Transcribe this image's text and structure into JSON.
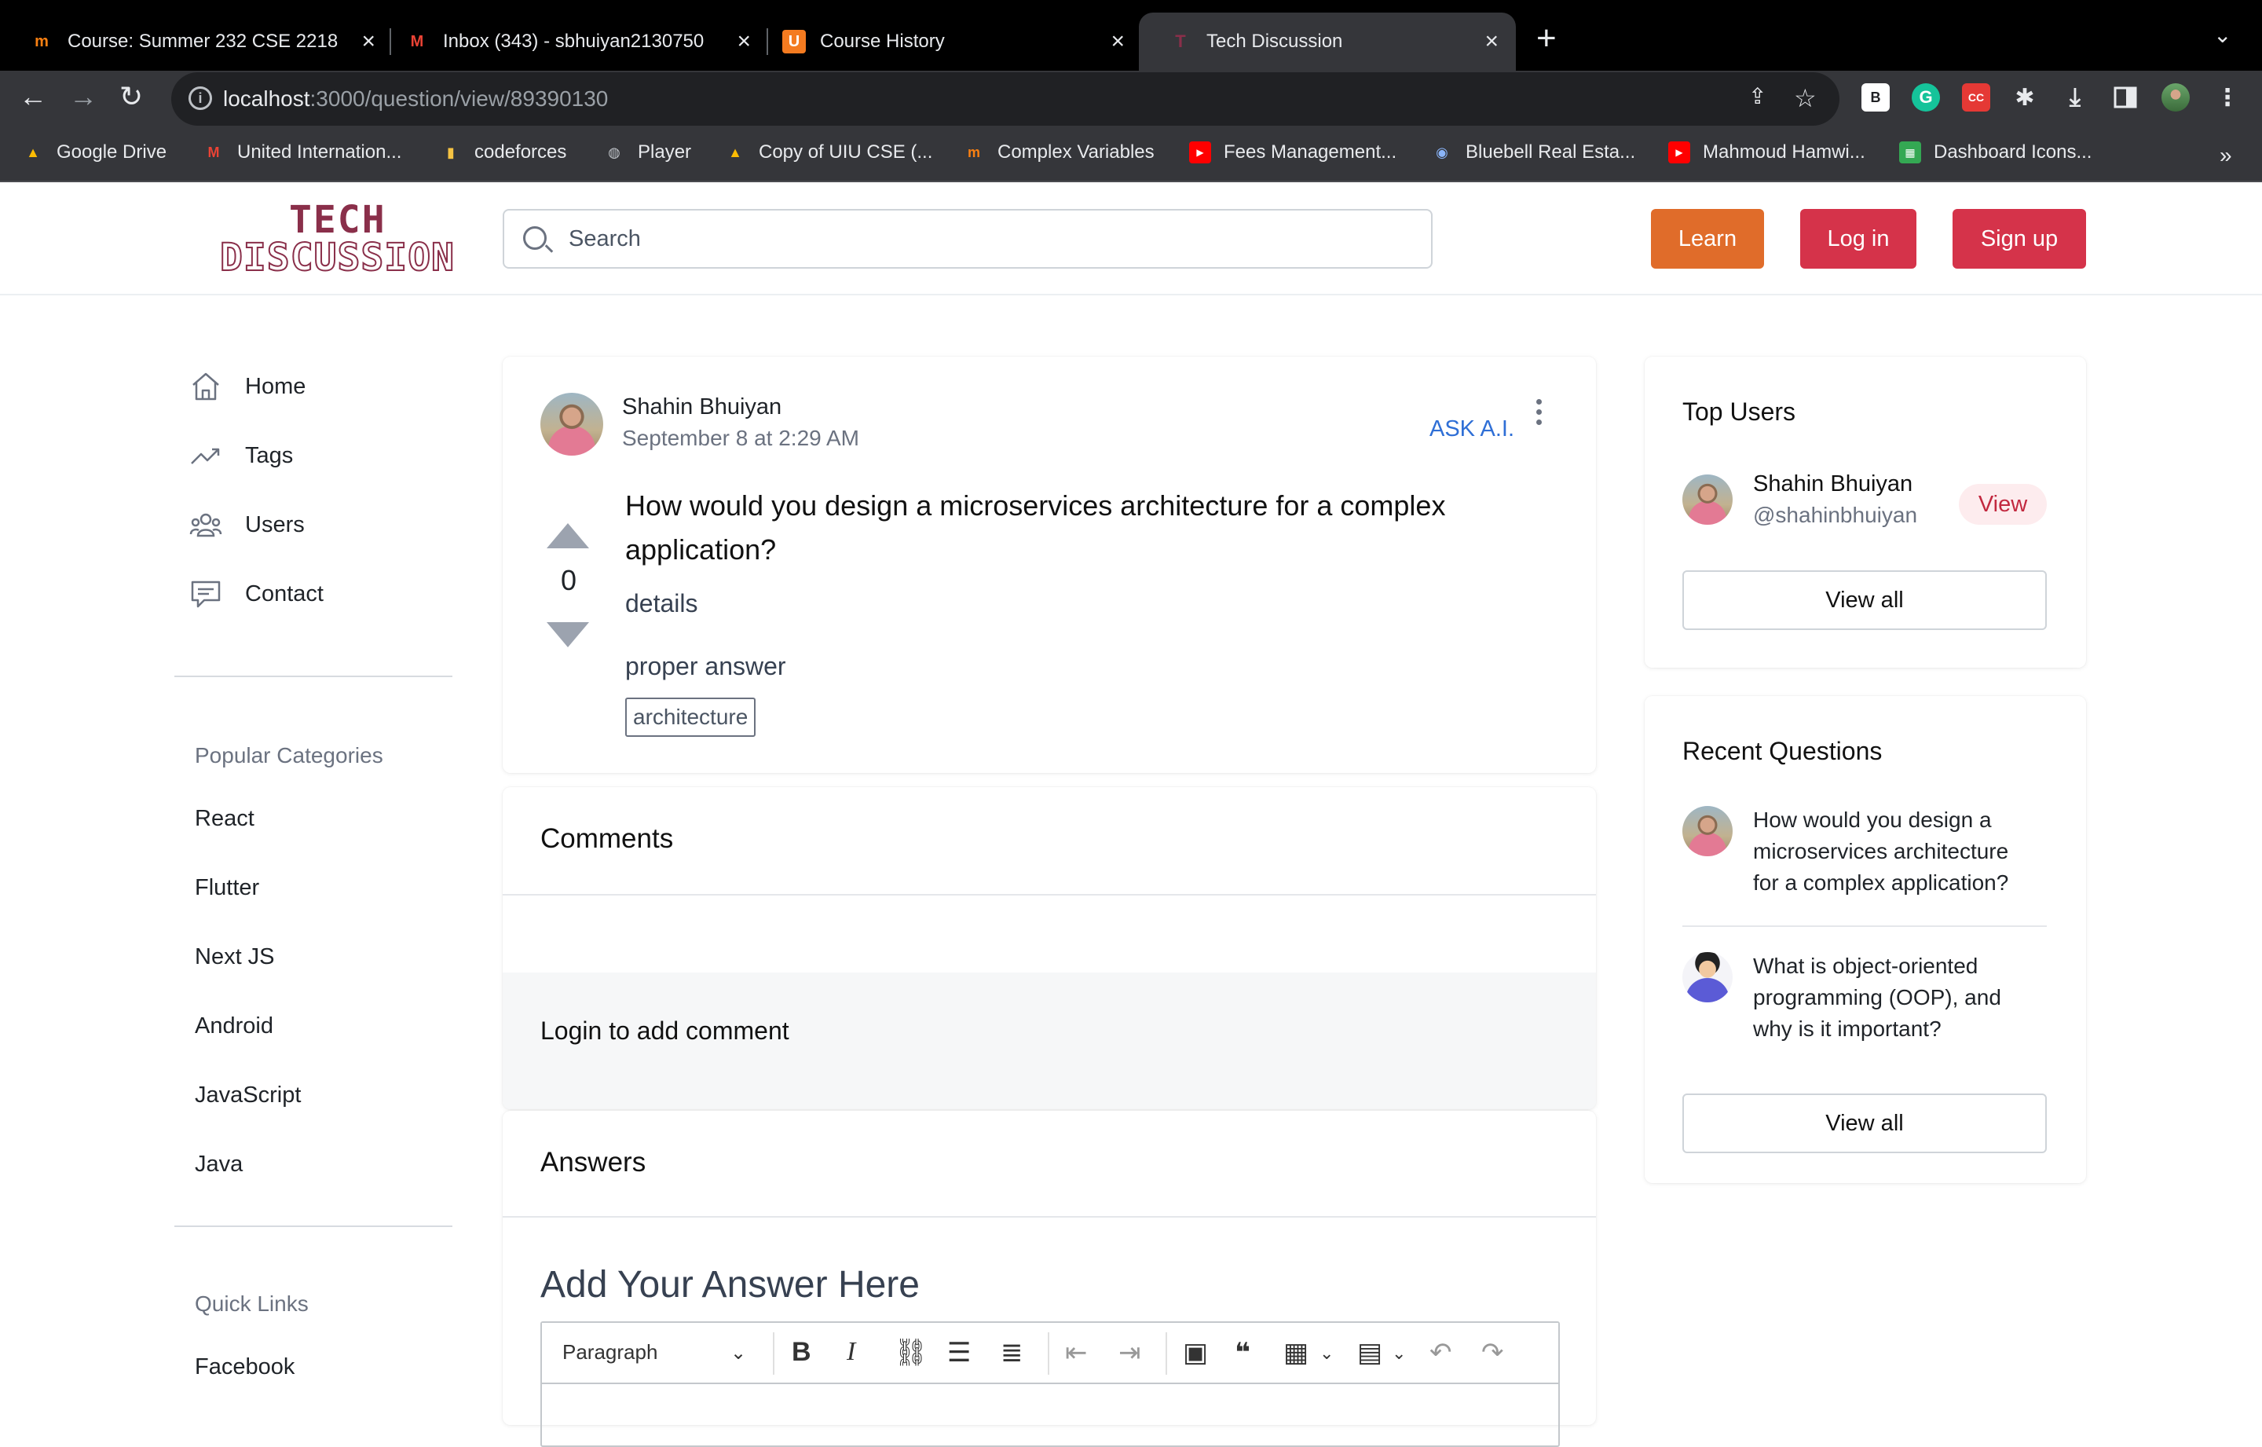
{
  "browser": {
    "tabs": [
      {
        "title": "Course: Summer 232 CSE 2218",
        "icon": "moodle-icon"
      },
      {
        "title": "Inbox (343) - sbhuiyan2130750",
        "icon": "gmail-icon"
      },
      {
        "title": "Course History",
        "icon": "ucam-icon"
      },
      {
        "title": "Tech Discussion",
        "icon": "tech-discussion-icon",
        "active": true
      }
    ],
    "url_host": "localhost",
    "url_path": ":3000/question/view/89390130",
    "bookmarks": [
      "Google Drive",
      "United Internation...",
      "codeforces",
      "Player",
      "Copy of UIU CSE (...",
      "Complex Variables",
      "Fees Management...",
      "Bluebell Real Esta...",
      "Mahmoud Hamwi...",
      "Dashboard Icons..."
    ],
    "bookmarks_more": "»"
  },
  "header": {
    "logo_top": "TECH",
    "logo_bottom": "DISCUSSION",
    "search_placeholder": "Search",
    "learn": "Learn",
    "login": "Log in",
    "signup": "Sign up"
  },
  "sidebar": {
    "nav": [
      {
        "label": "Home",
        "icon": "home-icon"
      },
      {
        "label": "Tags",
        "icon": "trending-icon"
      },
      {
        "label": "Users",
        "icon": "users-icon"
      },
      {
        "label": "Contact",
        "icon": "chat-icon"
      }
    ],
    "categories_title": "Popular Categories",
    "categories": [
      "React",
      "Flutter",
      "Next JS",
      "Android",
      "JavaScript",
      "Java"
    ],
    "quick_links_title": "Quick Links",
    "quick_links": [
      "Facebook"
    ]
  },
  "question": {
    "author": "Shahin Bhuiyan",
    "date": "September 8 at 2:29 AM",
    "ask_ai": "ASK A.I.",
    "votes": "0",
    "title": "How would you design a microservices architecture for a complex application?",
    "details": "details",
    "answer_text": "proper answer",
    "tags": [
      "architecture"
    ]
  },
  "comments": {
    "title": "Comments",
    "login_prompt": "Login to add comment"
  },
  "answers": {
    "title": "Answers",
    "add_title": "Add Your Answer Here",
    "editor_block": "Paragraph"
  },
  "top_users": {
    "title": "Top Users",
    "users": [
      {
        "name": "Shahin Bhuiyan",
        "handle": "@shahinbhuiyan",
        "action": "View"
      }
    ],
    "view_all": "View all"
  },
  "recent_questions": {
    "title": "Recent Questions",
    "items": [
      {
        "text": "How would you design a microservices architecture for a complex application?"
      },
      {
        "text": "What is object-oriented programming (OOP), and why is it important?"
      }
    ],
    "view_all": "View all"
  },
  "colors": {
    "brand": "#8a2f4a",
    "learn": "#e06c2a",
    "primary": "#d5334a",
    "link": "#2f6fd6"
  }
}
